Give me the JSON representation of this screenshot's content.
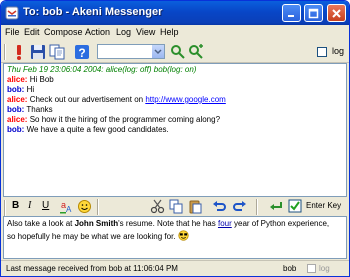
{
  "window": {
    "title": "To: bob - Akeni Messenger"
  },
  "menu": [
    "File",
    "Edit",
    "Compose",
    "Action",
    "Log",
    "View",
    "Help"
  ],
  "toolbar": {
    "log_label": "log"
  },
  "history": {
    "header": "Thu Feb 19 23:06:04 2004: alice(log: off) bob(log: on)",
    "messages": [
      {
        "sender": "alice:",
        "text": "Hi Bob"
      },
      {
        "sender": "bob:",
        "text": "Hi"
      },
      {
        "sender": "alice:",
        "text": "Check out our advertisement on ",
        "link": "http://www.google.com"
      },
      {
        "sender": "bob:",
        "text": "Thanks"
      },
      {
        "sender": "alice:",
        "text": "So how it the hiring of the programmer coming along?"
      },
      {
        "sender": "bob:",
        "text": "We have a quite a few good candidates."
      }
    ]
  },
  "format_toolbar": {
    "bold": "B",
    "italic": "I",
    "underline": "U",
    "enter_key_label": "Enter Key"
  },
  "compose": {
    "part1": "Also take a look at ",
    "name": "John Smith",
    "part2": "'s resume. Note that he has ",
    "four": "four",
    "part3": " year of Python experience,",
    "part4": "so hopefully he may be what we are looking for. "
  },
  "status": {
    "text": "Last message received from bob at 11:06:04 PM",
    "user": "bob",
    "log": "log"
  },
  "colors": {
    "title_bar": "#0a4fd6",
    "alice": "#ff0000",
    "bob": "#0000cc",
    "history_header": "#008000",
    "link": "#0000ff"
  }
}
